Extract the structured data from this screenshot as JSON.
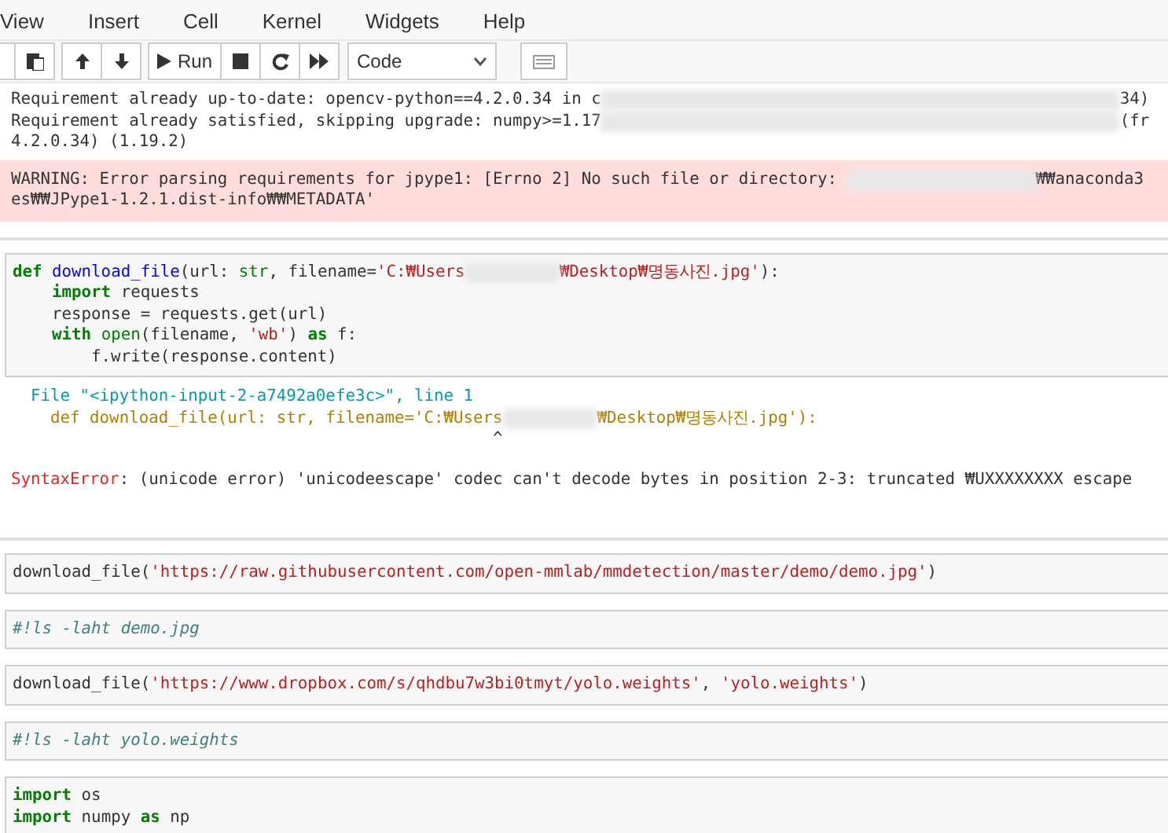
{
  "menu": [
    "View",
    "Insert",
    "Cell",
    "Kernel",
    "Widgets",
    "Help"
  ],
  "toolbar": {
    "run_label": "Run",
    "cell_type": "Code"
  },
  "output_1": {
    "stream": [
      [
        {
          "kind": "plain",
          "text": "Requirement already up-to-date: opencv-python==4.2.0.34 in c"
        },
        {
          "kind": "redacted"
        },
        {
          "kind": "plain",
          "text": "34)"
        }
      ],
      [
        {
          "kind": "plain",
          "text": "Requirement already satisfied, skipping upgrade: numpy>=1.17"
        },
        {
          "kind": "redacted"
        },
        {
          "kind": "plain",
          "text": "(fr"
        }
      ],
      [
        {
          "kind": "plain",
          "text": "4.2.0.34) (1.19.2)"
        }
      ]
    ],
    "warning": [
      [
        {
          "kind": "plain",
          "text": "WARNING: Error parsing requirements for jpype1: [Errno 2] No such file or directory: "
        },
        {
          "kind": "redacted"
        },
        {
          "kind": "plain",
          "text": "₩₩anaconda3"
        }
      ],
      [
        {
          "kind": "plain",
          "text": "es₩₩JPype1-1.2.1.dist-info₩₩METADATA'"
        }
      ]
    ]
  },
  "cells": [
    {
      "code": [
        [
          {
            "kind": "kw",
            "text": "def "
          },
          {
            "kind": "def",
            "text": "download_file"
          },
          {
            "kind": "plain",
            "text": "(url: "
          },
          {
            "kind": "builtin",
            "text": "str"
          },
          {
            "kind": "plain",
            "text": ", filename="
          },
          {
            "kind": "str",
            "text": "'C:₩Users"
          },
          {
            "kind": "redacted"
          },
          {
            "kind": "str",
            "text": "₩Desktop₩명동사진.jpg'"
          },
          {
            "kind": "plain",
            "text": "):"
          }
        ],
        [
          {
            "kind": "kw",
            "text": "    import"
          },
          {
            "kind": "plain",
            "text": " requests"
          }
        ],
        [
          {
            "kind": "plain",
            "text": "    response = requests.get(url)"
          }
        ],
        [
          {
            "kind": "kw",
            "text": "    with "
          },
          {
            "kind": "builtin",
            "text": "open"
          },
          {
            "kind": "plain",
            "text": "(filename, "
          },
          {
            "kind": "str",
            "text": "'wb'"
          },
          {
            "kind": "plain",
            "text": ") "
          },
          {
            "kind": "kw",
            "text": "as"
          },
          {
            "kind": "plain",
            "text": " f:"
          }
        ],
        [
          {
            "kind": "plain",
            "text": "        f.write(response.content)"
          }
        ]
      ],
      "output": [
        [
          {
            "kind": "tb-file",
            "text": "  File \"<ipython-input-2-a7492a0efe3c>\", line 1"
          }
        ],
        [
          {
            "kind": "tb-code",
            "text": "    def download_file(url: str, filename='C:₩Users"
          },
          {
            "kind": "redacted"
          },
          {
            "kind": "tb-code",
            "text": "₩Desktop₩명동사진.jpg'):"
          }
        ],
        [
          {
            "kind": "plain",
            "text": "                                                 ^"
          }
        ],
        [
          {
            "kind": "err",
            "text": "SyntaxError"
          },
          {
            "kind": "plain",
            "text": ": (unicode error) 'unicodeescape' codec can't decode bytes in position 2-3: truncated ₩UXXXXXXXX escape"
          }
        ]
      ]
    },
    {
      "code": [
        [
          {
            "kind": "plain",
            "text": "download_file("
          },
          {
            "kind": "str",
            "text": "'https://raw.githubusercontent.com/open-mmlab/mmdetection/master/demo/demo.jpg'"
          },
          {
            "kind": "plain",
            "text": ")"
          }
        ]
      ]
    },
    {
      "code": [
        [
          {
            "kind": "comment",
            "text": "#!ls -laht demo.jpg"
          }
        ]
      ]
    },
    {
      "code": [
        [
          {
            "kind": "plain",
            "text": "download_file("
          },
          {
            "kind": "str",
            "text": "'https://www.dropbox.com/s/qhdbu7w3bi0tmyt/yolo.weights'"
          },
          {
            "kind": "plain",
            "text": ", "
          },
          {
            "kind": "str",
            "text": "'yolo.weights'"
          },
          {
            "kind": "plain",
            "text": ")"
          }
        ]
      ]
    },
    {
      "code": [
        [
          {
            "kind": "comment",
            "text": "#!ls -laht yolo.weights"
          }
        ]
      ]
    },
    {
      "code": [
        [
          {
            "kind": "kw",
            "text": "import"
          },
          {
            "kind": "plain",
            "text": " os"
          }
        ],
        [
          {
            "kind": "kw",
            "text": "import"
          },
          {
            "kind": "plain",
            "text": " numpy "
          },
          {
            "kind": "kw",
            "text": "as"
          },
          {
            "kind": "plain",
            "text": " np"
          }
        ]
      ]
    }
  ]
}
